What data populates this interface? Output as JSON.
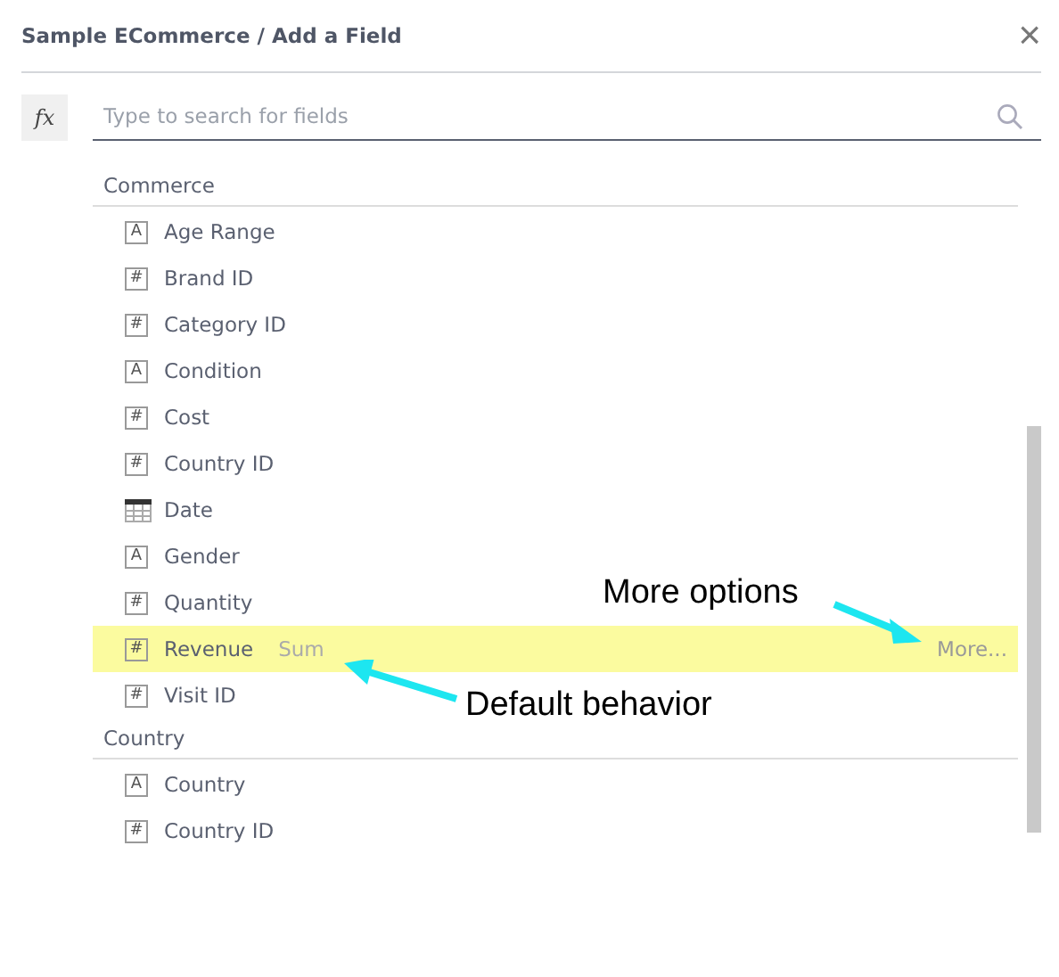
{
  "dialog": {
    "title": "Sample ECommerce / Add a Field",
    "close": "×"
  },
  "formula_button": {
    "label": "fx"
  },
  "search": {
    "placeholder": "Type to search for fields"
  },
  "groups": [
    {
      "name": "Commerce",
      "fields": [
        {
          "kind": "text",
          "icon": "A",
          "label": "Age Range",
          "selected": false
        },
        {
          "kind": "number",
          "icon": "#",
          "label": "Brand ID",
          "selected": false
        },
        {
          "kind": "number",
          "icon": "#",
          "label": "Category ID",
          "selected": false
        },
        {
          "kind": "text",
          "icon": "A",
          "label": "Condition",
          "selected": false
        },
        {
          "kind": "number",
          "icon": "#",
          "label": "Cost",
          "selected": false
        },
        {
          "kind": "number",
          "icon": "#",
          "label": "Country ID",
          "selected": false
        },
        {
          "kind": "date",
          "label": "Date",
          "selected": false
        },
        {
          "kind": "text",
          "icon": "A",
          "label": "Gender",
          "selected": false
        },
        {
          "kind": "number",
          "icon": "#",
          "label": "Quantity",
          "selected": false
        },
        {
          "kind": "number",
          "icon": "#",
          "label": "Revenue",
          "selected": true,
          "behavior": "Sum",
          "more": "More..."
        },
        {
          "kind": "number",
          "icon": "#",
          "label": "Visit ID",
          "selected": false
        }
      ]
    },
    {
      "name": "Country",
      "fields": [
        {
          "kind": "text",
          "icon": "A",
          "label": "Country",
          "selected": false
        },
        {
          "kind": "number",
          "icon": "#",
          "label": "Country ID",
          "selected": false
        }
      ]
    }
  ],
  "annotations": [
    {
      "kind": "more",
      "text": "More options"
    },
    {
      "kind": "default",
      "text": "Default behavior"
    }
  ]
}
